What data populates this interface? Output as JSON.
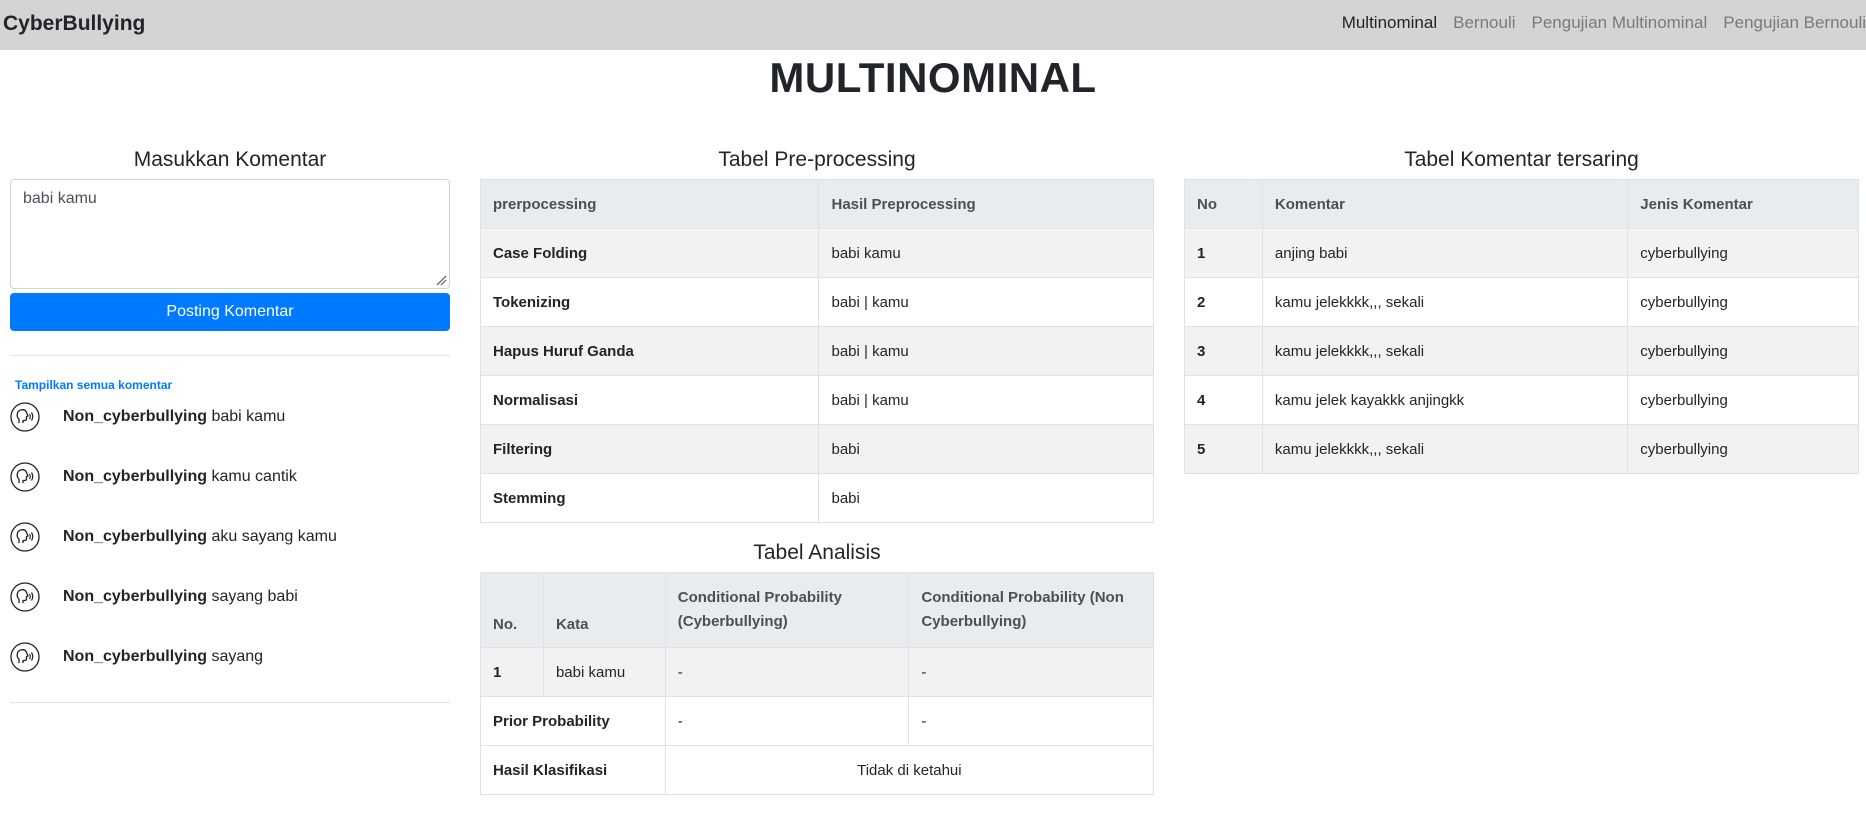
{
  "navbar": {
    "brand": "CyberBullying",
    "links": [
      "Multinominal",
      "Bernouli",
      "Pengujian Multinominal",
      "Pengujian Bernouli"
    ]
  },
  "page_title": "MULTINOMINAL",
  "input_section": {
    "heading": "Masukkan Komentar",
    "textarea_value": "babi kamu",
    "button_label": "Posting Komentar",
    "show_all_link": "Tampilkan semua komentar",
    "comments": [
      {
        "label": "Non_cyberbullying",
        "text": "babi kamu"
      },
      {
        "label": "Non_cyberbullying",
        "text": "kamu cantik"
      },
      {
        "label": "Non_cyberbullying",
        "text": "aku sayang kamu"
      },
      {
        "label": "Non_cyberbullying",
        "text": "sayang babi"
      },
      {
        "label": "Non_cyberbullying",
        "text": "sayang"
      }
    ]
  },
  "preprocessing": {
    "heading": "Tabel Pre-processing",
    "headers": [
      "prerpocessing",
      "Hasil Preprocessing"
    ],
    "rows": [
      [
        "Case Folding",
        "babi kamu"
      ],
      [
        "Tokenizing",
        "babi | kamu"
      ],
      [
        "Hapus Huruf Ganda",
        "babi | kamu"
      ],
      [
        "Normalisasi",
        "babi | kamu"
      ],
      [
        "Filtering",
        "babi"
      ],
      [
        "Stemming",
        "babi"
      ]
    ]
  },
  "analisis": {
    "heading": "Tabel Analisis",
    "headers": [
      "No.",
      "Kata",
      "Conditional Probability (Cyberbullying)",
      "Conditional Probability (Non Cyberbullying)"
    ],
    "row": [
      "1",
      "babi kamu",
      "-",
      "-"
    ],
    "prior_label": "Prior Probability",
    "prior_values": [
      "-",
      "-"
    ],
    "hasil_label": "Hasil Klasifikasi",
    "hasil_value": "Tidak di ketahui"
  },
  "filtered": {
    "heading": "Tabel Komentar tersaring",
    "headers": [
      "No",
      "Komentar",
      "Jenis Komentar"
    ],
    "rows": [
      [
        "1",
        "anjing babi",
        "cyberbullying"
      ],
      [
        "2",
        "kamu jelekkkk,,, sekali",
        "cyberbullying"
      ],
      [
        "3",
        "kamu jelekkkk,,, sekali",
        "cyberbullying"
      ],
      [
        "4",
        "kamu jelek kayakkk anjingkk",
        "cyberbullying"
      ],
      [
        "5",
        "kamu jelekkkk,,, sekali",
        "cyberbullying"
      ]
    ]
  }
}
